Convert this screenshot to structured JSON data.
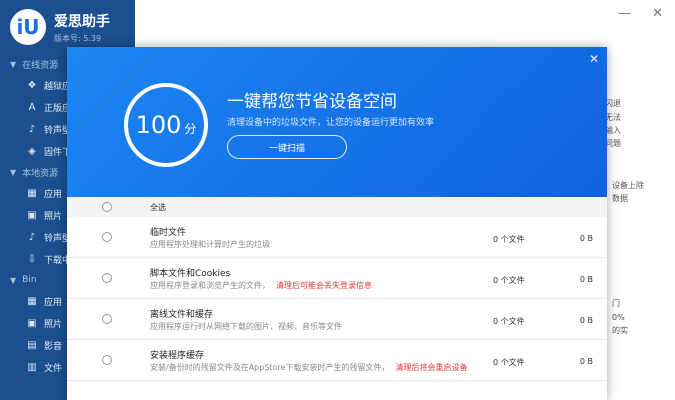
{
  "app": {
    "title": "爱思助手",
    "version": "版本号: 5.39",
    "logo_glyph": "iU"
  },
  "sidebar": {
    "sections": [
      {
        "label": "在线资源",
        "items": [
          {
            "icon": "box-icon",
            "glyph": "❖",
            "label": "越狱应"
          },
          {
            "icon": "app-icon",
            "glyph": "A",
            "label": "正版应"
          },
          {
            "icon": "bell-icon",
            "glyph": "♪",
            "label": "铃声壁"
          },
          {
            "icon": "firmware-icon",
            "glyph": "◈",
            "label": "固件下"
          }
        ]
      },
      {
        "label": "本地资源",
        "items": [
          {
            "icon": "apps-grid-icon",
            "glyph": "▦",
            "label": "应用"
          },
          {
            "icon": "photo-icon",
            "glyph": "▣",
            "label": "照片"
          },
          {
            "icon": "bell-icon",
            "glyph": "♪",
            "label": "铃声壁"
          },
          {
            "icon": "download-icon",
            "glyph": "⇩",
            "label": "下载中"
          }
        ]
      },
      {
        "label": "Bin",
        "items": [
          {
            "icon": "apps-grid-icon",
            "glyph": "▦",
            "label": "应用"
          },
          {
            "icon": "photo-icon",
            "glyph": "▣",
            "label": "照片"
          },
          {
            "icon": "film-icon",
            "glyph": "▤",
            "label": "影音"
          },
          {
            "icon": "file-icon",
            "glyph": "▥",
            "label": "文件"
          }
        ]
      }
    ]
  },
  "background": {
    "right_snippets": [
      "闪退",
      "无法",
      "输入",
      "问题",
      "设备上除",
      "数据",
      "门",
      "0%",
      "的实"
    ]
  },
  "modal": {
    "close_glyph": "✕",
    "score": "100",
    "score_unit": "分",
    "score_fraction": 1.0,
    "title": "一键帮您节省设备空间",
    "subtitle": "清理设备中的垃圾文件，让您的设备运行更加有效率",
    "scan_button": "一键扫描",
    "select_all": "全选",
    "rows": [
      {
        "title": "临时文件",
        "desc": "应用程序处理和计算时产生的垃圾",
        "warn": "",
        "count": "0 个文件",
        "size": "0 B"
      },
      {
        "title": "脚本文件和Cookies",
        "desc": "应用程序登录和浏览产生的文件，",
        "warn": "清理后可能会丢失登录信息",
        "count": "0 个文件",
        "size": "0 B"
      },
      {
        "title": "离线文件和缓存",
        "desc": "应用程序运行时从网络下载的图片、视频、音乐等文件",
        "warn": "",
        "count": "0 个文件",
        "size": "0 B"
      },
      {
        "title": "安装程序缓存",
        "desc": "安装/备份时的残留文件及在AppStore下载安装时产生的残留文件，",
        "warn": "清理后将会重启设备",
        "count": "0 个文件",
        "size": "0 B"
      }
    ]
  },
  "colors": {
    "sidebar_bg": "#1b4f8f",
    "modal_header": "#1377ea",
    "warning": "#e43b3b"
  }
}
